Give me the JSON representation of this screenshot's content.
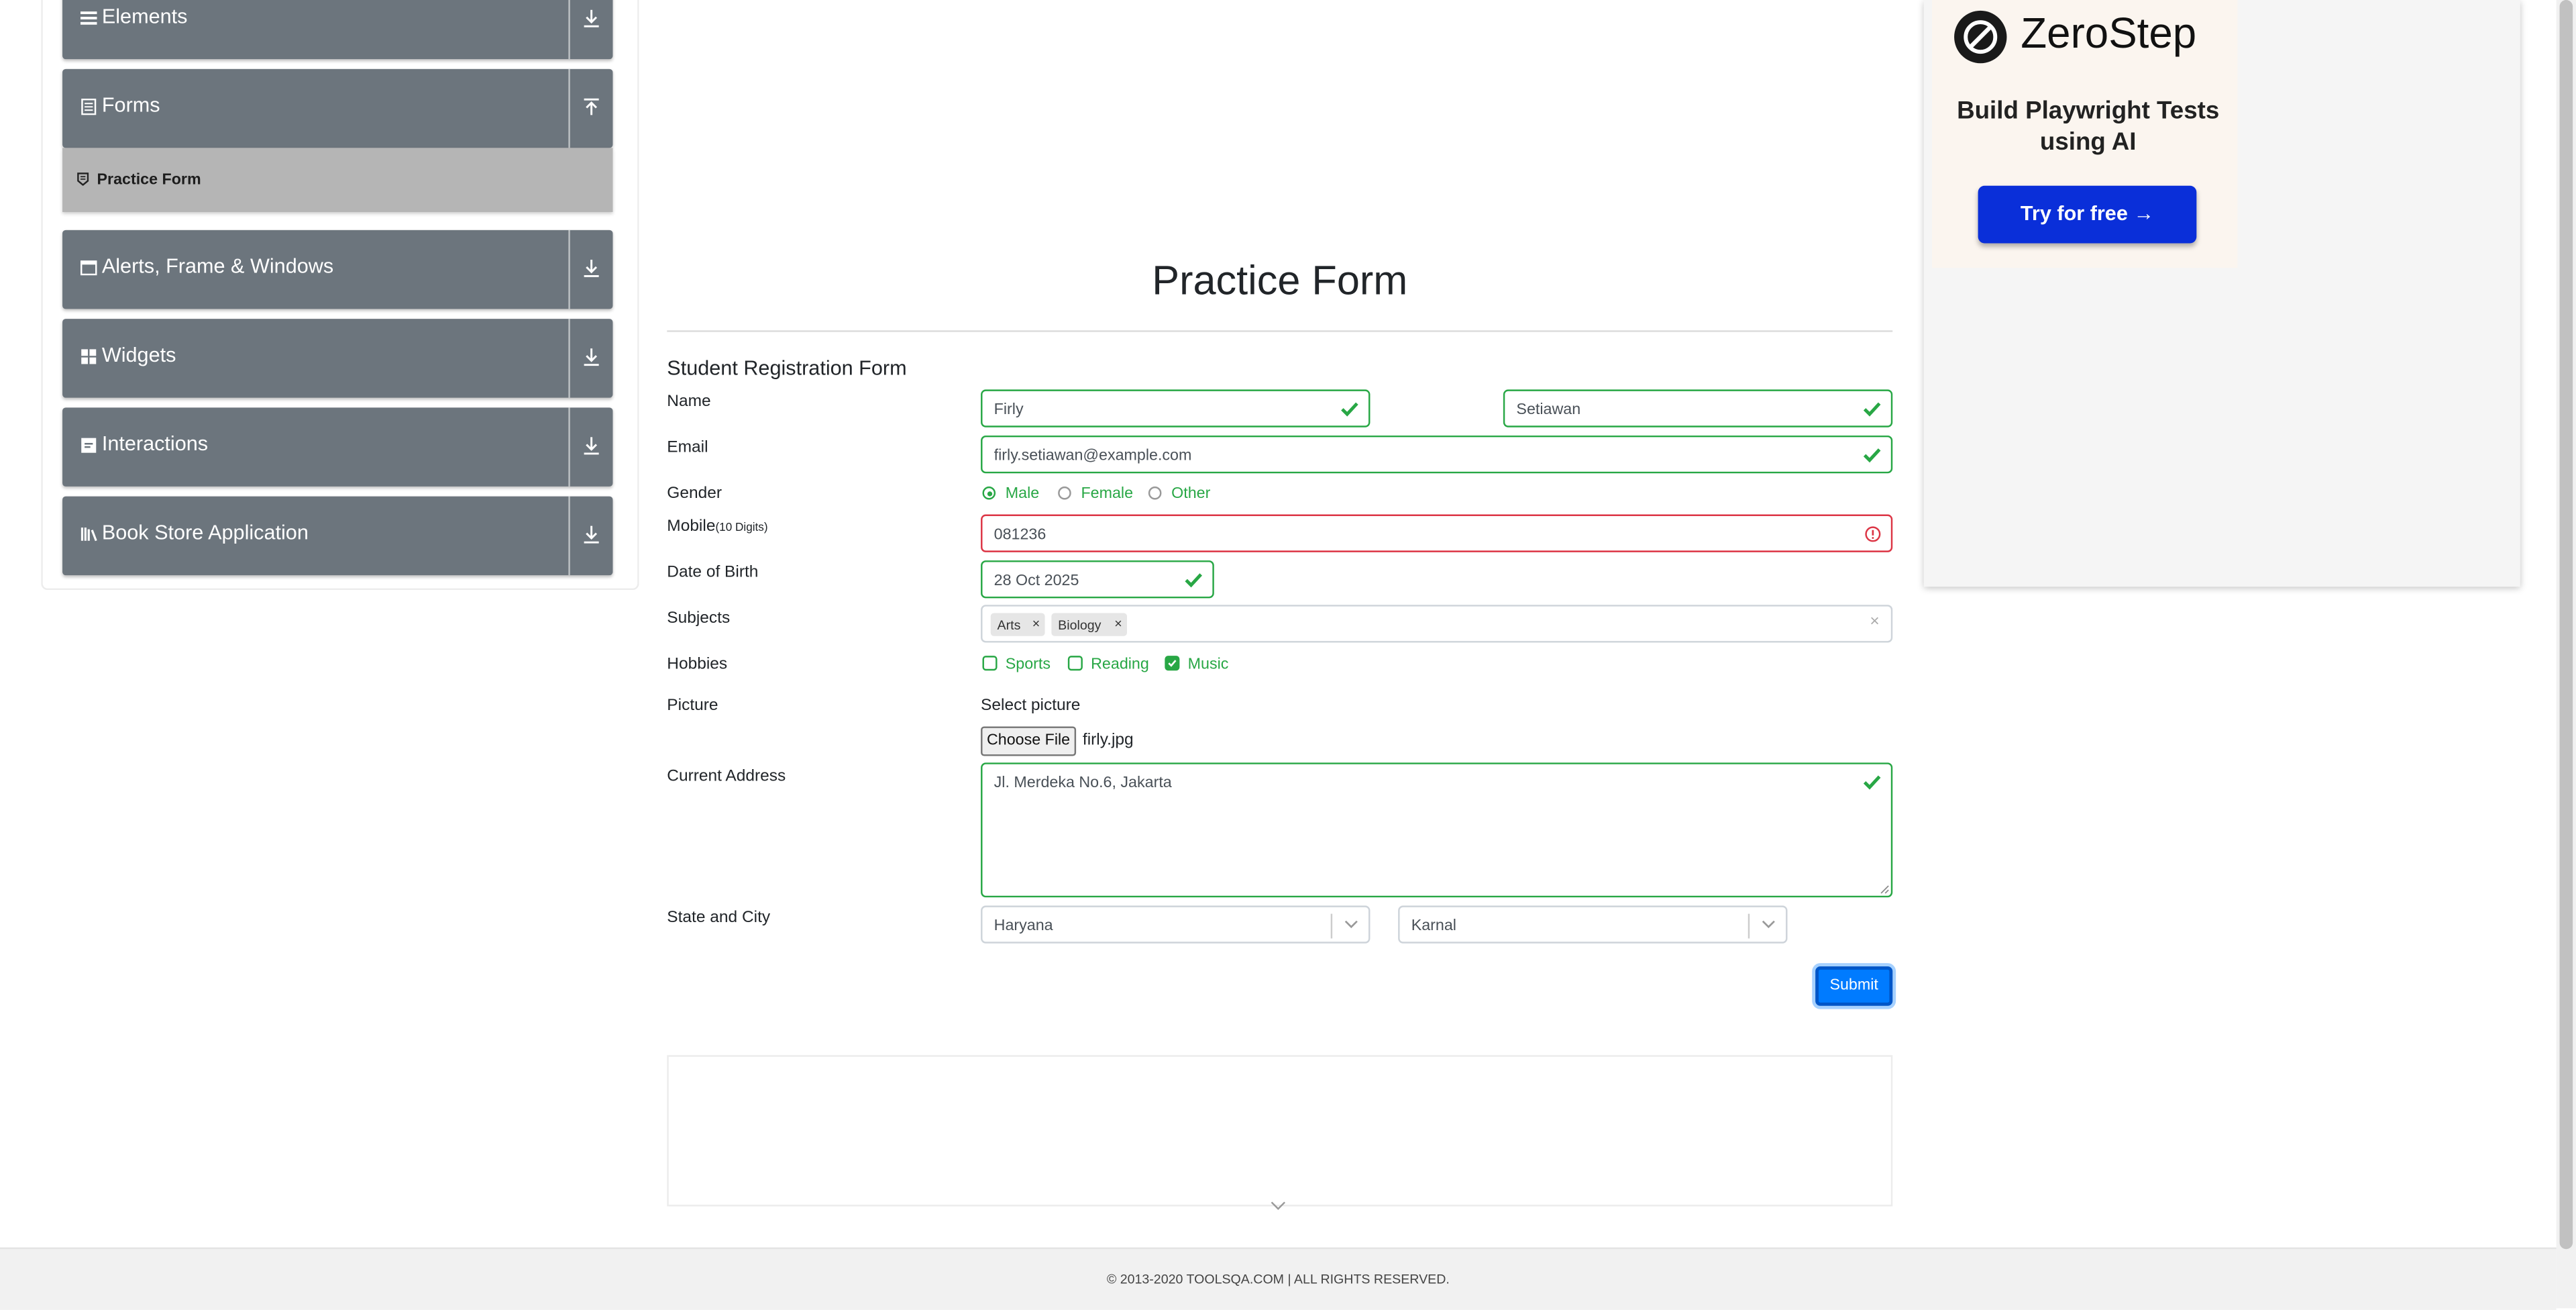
{
  "sidebar": {
    "groups": [
      {
        "label": "Elements",
        "icon": "hamburger-icon",
        "arrow": "expand-icon"
      },
      {
        "label": "Forms",
        "icon": "document-icon",
        "arrow": "collapse-icon"
      },
      {
        "label": "Alerts, Frame & Windows",
        "icon": "window-icon",
        "arrow": "expand-icon"
      },
      {
        "label": "Widgets",
        "icon": "widgets-icon",
        "arrow": "expand-icon"
      },
      {
        "label": "Interactions",
        "icon": "interactions-icon",
        "arrow": "expand-icon"
      },
      {
        "label": "Book Store Application",
        "icon": "books-icon",
        "arrow": "expand-icon"
      }
    ],
    "active_item": {
      "label": "Practice Form",
      "icon": "tag-icon"
    }
  },
  "page": {
    "title": "Practice Form"
  },
  "form": {
    "heading": "Student Registration Form",
    "name": {
      "label": "Name",
      "first_value": "Firly",
      "last_value": "Setiawan"
    },
    "email": {
      "label": "Email",
      "value": "firly.setiawan@example.com"
    },
    "gender": {
      "label": "Gender",
      "options": [
        "Male",
        "Female",
        "Other"
      ],
      "selected": "Male"
    },
    "mobile": {
      "label": "Mobile",
      "hint": "(10 Digits)",
      "value": "081236",
      "status": "invalid"
    },
    "dob": {
      "label": "Date of Birth",
      "value": "28 Oct 2025"
    },
    "subjects": {
      "label": "Subjects",
      "chips": [
        "Arts",
        "Biology"
      ],
      "remove_glyph": "×",
      "clear_glyph": "×"
    },
    "hobbies": {
      "label": "Hobbies",
      "options": [
        "Sports",
        "Reading",
        "Music"
      ],
      "checked": [
        "Music"
      ]
    },
    "picture": {
      "label": "Picture",
      "prompt": "Select picture",
      "button": "Choose File",
      "filename": "firly.jpg"
    },
    "address": {
      "label": "Current Address",
      "value": "Jl. Merdeka No.6, Jakarta"
    },
    "state_city": {
      "label": "State and City",
      "state": "Haryana",
      "city": "Karnal"
    },
    "submit": "Submit"
  },
  "ad": {
    "brand": "ZeroStep",
    "tagline": "Build Playwright Tests using AI",
    "button": "Try for free →"
  },
  "footer": {
    "text": "© 2013-2020 TOOLSQA.COM | ALL RIGHTS RESERVED."
  },
  "colors": {
    "valid": "#28a745",
    "invalid": "#dc3545",
    "primary": "#007bff",
    "sidebar_group": "#6c757d",
    "ad_button": "#0a2fd9"
  }
}
